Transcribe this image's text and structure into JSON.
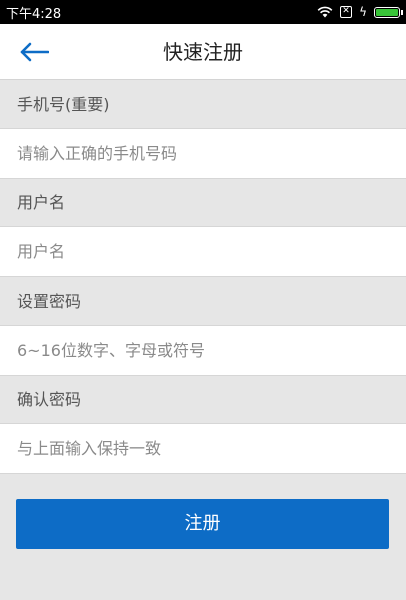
{
  "status_bar": {
    "time": "下午4:28",
    "icons": [
      "wifi-icon",
      "sim-icon",
      "charging-icon",
      "battery-icon"
    ],
    "sim_glyph": "✕",
    "bolt_glyph": "ϟ"
  },
  "header": {
    "back_icon": "arrow-left-icon",
    "title": "快速注册"
  },
  "form": {
    "phone": {
      "label": "手机号(重要)",
      "placeholder": "请输入正确的手机号码"
    },
    "username": {
      "label": "用户名",
      "placeholder": "用户名"
    },
    "password": {
      "label": "设置密码",
      "placeholder": "6~16位数字、字母或符号"
    },
    "confirm_password": {
      "label": "确认密码",
      "placeholder": "与上面输入保持一致"
    },
    "submit_label": "注册"
  },
  "colors": {
    "accent": "#0d6cc6",
    "background": "#e6e6e6",
    "battery": "#38c438"
  }
}
